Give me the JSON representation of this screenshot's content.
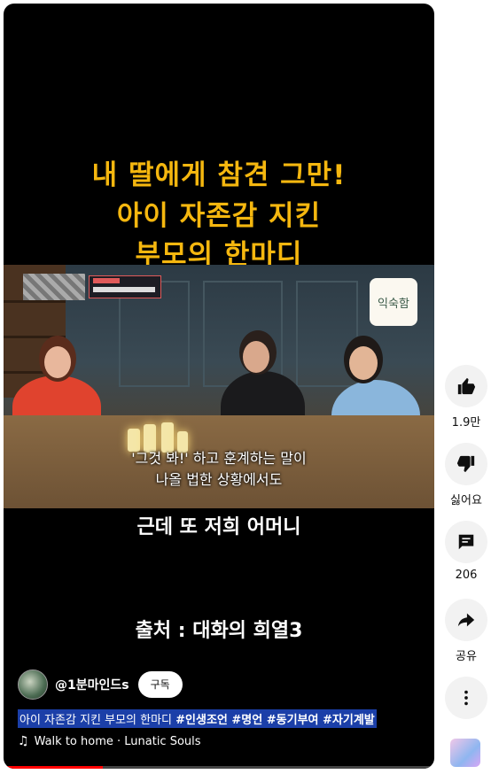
{
  "video": {
    "title_lines": [
      "내 딸에게 참견 그만!",
      "아이 자존감 지킨",
      "부모의 한마디"
    ],
    "scene_logo": "익숙함",
    "caption_line1": "'그것 봐!' 하고 훈계하는 말이",
    "caption_line2": "나올 법한 상황에서도",
    "subtitle": "근데 또 저희 어머니",
    "source": "출처 : 대화의 희열3",
    "progress_fraction": 0.23
  },
  "channel": {
    "name": "@1분마인드s",
    "subscribe_label": "구독"
  },
  "description": {
    "text": "아이 자존감 지킨 부모의 한마디 ",
    "tags": "#인생조언 #명언 #동기부여 #자기계발"
  },
  "music": {
    "track": "Walk to home · Lunatic Souls"
  },
  "actions": {
    "like_count": "1.9만",
    "dislike_label": "싫어요",
    "comment_count": "206",
    "share_label": "공유"
  },
  "icons": [
    "thumbs-up-icon",
    "thumbs-down-icon",
    "comment-icon",
    "share-icon",
    "more-icon",
    "music-note-icon"
  ]
}
